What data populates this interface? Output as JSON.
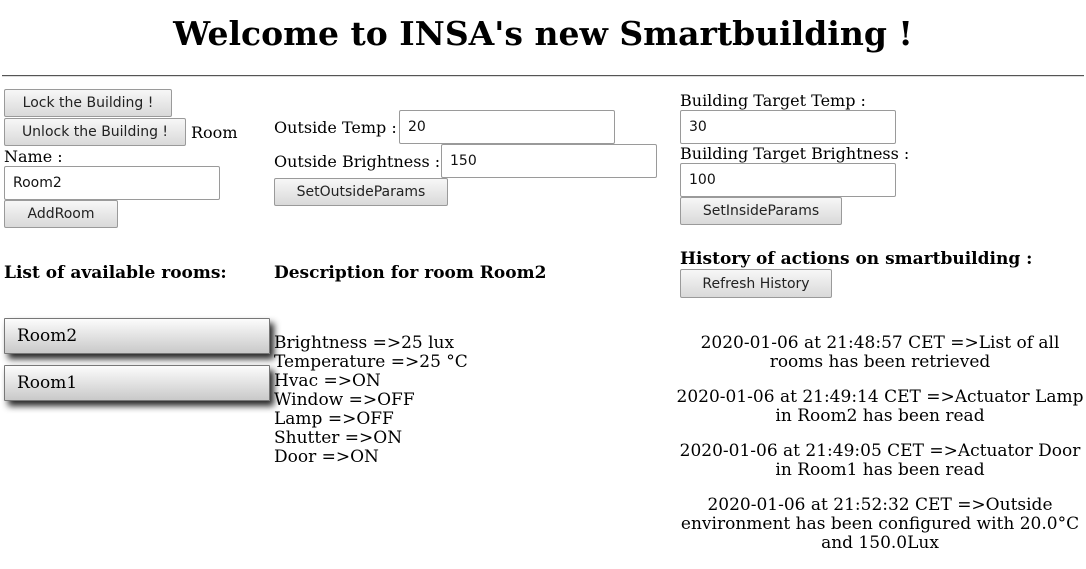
{
  "page": {
    "title": "Welcome to INSA's new Smartbuilding !"
  },
  "controls": {
    "lock_label": "Lock the Building !",
    "unlock_label": "Unlock the Building !",
    "room_name_label_a": "Room",
    "room_name_label_b": "Name :",
    "room_name_value": "Room2",
    "add_room_label": "AddRoom"
  },
  "outside": {
    "temp_label": "Outside Temp :",
    "temp_value": "20",
    "brightness_label": "Outside Brightness :",
    "brightness_value": "150",
    "set_label": "SetOutsideParams"
  },
  "inside": {
    "temp_label": "Building Target Temp :",
    "temp_value": "30",
    "brightness_label": "Building Target Brightness :",
    "brightness_value": "100",
    "set_label": "SetInsideParams"
  },
  "rooms": {
    "heading": "List of available rooms:",
    "items": [
      "Room2",
      "Room1"
    ]
  },
  "description": {
    "heading": "Description for room Room2",
    "lines": [
      "Brightness =>25 lux",
      "Temperature =>25 °C",
      "Hvac =>ON",
      "Window =>OFF",
      "Lamp =>OFF",
      "Shutter =>ON",
      "Door =>ON"
    ]
  },
  "history": {
    "heading": "History of actions on smartbuilding :",
    "refresh_label": "Refresh History",
    "entries": [
      "2020-01-06 at 21:48:57 CET =>List of all rooms has been retrieved",
      "2020-01-06 at 21:49:14 CET =>Actuator Lamp in Room2 has been read",
      "2020-01-06 at 21:49:05 CET =>Actuator Door in Room1 has been read",
      "2020-01-06 at 21:52:32 CET =>Outside environment has been configured with 20.0°C and 150.0Lux"
    ]
  }
}
